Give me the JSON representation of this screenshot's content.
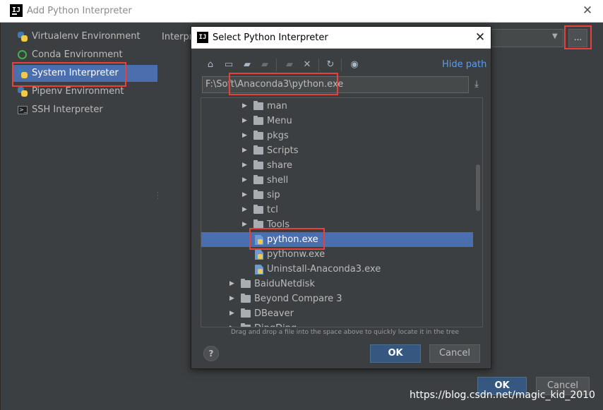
{
  "outer": {
    "title": "Add Python Interpreter",
    "close_label": "✕",
    "app_icon": "IJ",
    "nav": [
      {
        "label": "Virtualenv Environment",
        "icon": "python-icon"
      },
      {
        "label": "Conda Environment",
        "icon": "conda-icon"
      },
      {
        "label": "System Interpreter",
        "icon": "python-icon",
        "selected": true
      },
      {
        "label": "Pipenv Environment",
        "icon": "python-icon"
      },
      {
        "label": "SSH Interpreter",
        "icon": "ssh-icon"
      }
    ],
    "interpreter_label": "Interpreter:",
    "browse_label": "...",
    "ok_label": "OK",
    "cancel_label": "Cancel"
  },
  "inner": {
    "title": "Select Python Interpreter",
    "close_label": "✕",
    "app_icon": "IJ",
    "hide_path_label": "Hide path",
    "path_value": "F:\\Soft\\Anaconda3\\python.exe",
    "tree": [
      {
        "label": "man",
        "type": "folder",
        "level": 1
      },
      {
        "label": "Menu",
        "type": "folder",
        "level": 1
      },
      {
        "label": "pkgs",
        "type": "folder",
        "level": 1
      },
      {
        "label": "Scripts",
        "type": "folder",
        "level": 1
      },
      {
        "label": "share",
        "type": "folder",
        "level": 1
      },
      {
        "label": "shell",
        "type": "folder",
        "level": 1
      },
      {
        "label": "sip",
        "type": "folder",
        "level": 1
      },
      {
        "label": "tcl",
        "type": "folder",
        "level": 1
      },
      {
        "label": "Tools",
        "type": "folder",
        "level": 1
      },
      {
        "label": "python.exe",
        "type": "file",
        "level": 1,
        "selected": true
      },
      {
        "label": "pythonw.exe",
        "type": "file",
        "level": 1
      },
      {
        "label": "Uninstall-Anaconda3.exe",
        "type": "file",
        "level": 1
      },
      {
        "label": "BaiduNetdisk",
        "type": "folder",
        "level": 0
      },
      {
        "label": "Beyond Compare 3",
        "type": "folder",
        "level": 0
      },
      {
        "label": "DBeaver",
        "type": "folder",
        "level": 0
      },
      {
        "label": "DingDing",
        "type": "folder",
        "level": 0
      }
    ],
    "drag_hint": "Drag and drop a file into the space above to quickly locate it in the tree",
    "help_label": "?",
    "ok_label": "OK",
    "cancel_label": "Cancel"
  },
  "watermark": "https://blog.csdn.net/magic_kid_2010",
  "colors": {
    "accent": "#4b6eaf",
    "highlight": "#e8403a",
    "link": "#589df6",
    "background": "#3c3f41"
  }
}
